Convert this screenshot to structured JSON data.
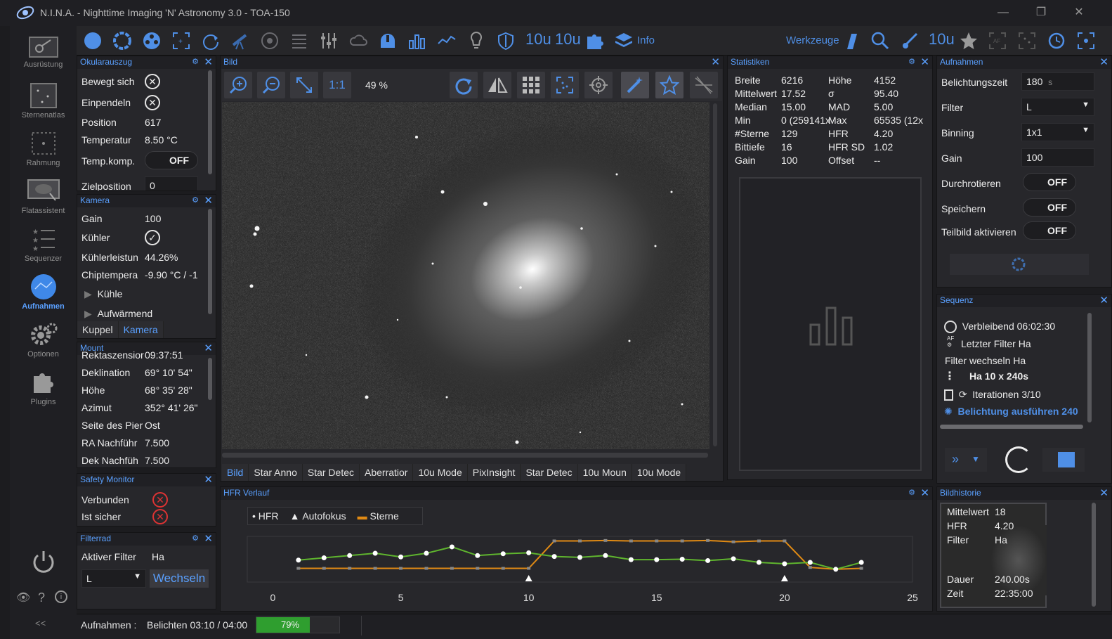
{
  "window": {
    "title": "N.I.N.A. - Nighttime Imaging 'N' Astronomy 3.0  -  TOA-150",
    "minimize": "—",
    "maximize": "❐",
    "close": "✕"
  },
  "sidebar": {
    "items": [
      {
        "label": "Ausrüstung",
        "icon": "camera-equipment-icon"
      },
      {
        "label": "Sternenatlas",
        "icon": "star-map-icon"
      },
      {
        "label": "Rahmung",
        "icon": "framing-icon"
      },
      {
        "label": "Flatassistent",
        "icon": "flat-wizard-icon"
      },
      {
        "label": "Sequenzer",
        "icon": "sequencer-icon"
      },
      {
        "label": "Aufnahmen",
        "icon": "imaging-icon",
        "active": true
      },
      {
        "label": "Optionen",
        "icon": "gear-icon"
      },
      {
        "label": "Plugins",
        "icon": "puzzle-icon"
      }
    ],
    "collapse": "<<"
  },
  "toolbar": {
    "info_label": "Info",
    "tools_label": "Werkzeuge",
    "ten_u": "10u"
  },
  "focuser": {
    "title": "Okularauszug",
    "rows": [
      {
        "label": "Bewegt sich",
        "value": ""
      },
      {
        "label": "Einpendeln",
        "value": ""
      },
      {
        "label": "Position",
        "value": "617"
      },
      {
        "label": "Temperatur",
        "value": "8.50 °C"
      },
      {
        "label": "Temp.komp.",
        "value": "OFF"
      },
      {
        "label": "Zielposition",
        "value": "0"
      }
    ]
  },
  "camera": {
    "title": "Kamera",
    "rows": [
      {
        "label": "Gain",
        "value": "100"
      },
      {
        "label": "Kühler",
        "value": ""
      },
      {
        "label": "Kühlerleistun",
        "value": "44.26%"
      },
      {
        "label": "Chiptempera",
        "value": "-9.90 °C / -1"
      }
    ],
    "expanders": [
      "Kühle",
      "Aufwärmend"
    ],
    "tabs": [
      "Kuppel",
      "Kamera"
    ]
  },
  "mount": {
    "title": "Mount",
    "rows": [
      {
        "label": "Rektaszensior",
        "value": "09:37:51"
      },
      {
        "label": "Deklination",
        "value": "69° 10' 54\""
      },
      {
        "label": "Höhe",
        "value": "68° 35' 28\""
      },
      {
        "label": "Azimut",
        "value": "352° 41' 26\""
      },
      {
        "label": "Seite des Pier",
        "value": "Ost"
      },
      {
        "label": "RA Nachführ",
        "value": "7.500"
      },
      {
        "label": "Dek Nachfüh",
        "value": "7.500"
      }
    ]
  },
  "safety": {
    "title": "Safety Monitor",
    "rows": [
      {
        "label": "Verbunden"
      },
      {
        "label": "Ist sicher"
      }
    ]
  },
  "filterwheel": {
    "title": "Filterrad",
    "active_label": "Aktiver Filter",
    "active_value": "Ha",
    "select_value": "L",
    "change_button": "Wechseln"
  },
  "image": {
    "title": "Bild",
    "one_to_one": "1:1",
    "zoom": "49 %",
    "tabs": [
      "Bild",
      "Star Anno",
      "Star Detec",
      "Aberratior",
      "10u Mode",
      "PixInsight",
      "Star Detec",
      "10u Moun",
      "10u Mode"
    ]
  },
  "statistics": {
    "title": "Statistiken",
    "rows": [
      {
        "l1": "Breite",
        "v1": "6216",
        "l2": "Höhe",
        "v2": "4152"
      },
      {
        "l1": "Mittelwert",
        "v1": "17.52",
        "l2": "σ",
        "v2": "95.40"
      },
      {
        "l1": "Median",
        "v1": "15.00",
        "l2": "MAD",
        "v2": "5.00"
      },
      {
        "l1": "Min",
        "v1": "0 (259141x",
        "l2": "Max",
        "v2": "65535 (12x"
      },
      {
        "l1": "#Sterne",
        "v1": "129",
        "l2": "HFR",
        "v2": "4.20"
      },
      {
        "l1": "Bittiefe",
        "v1": "16",
        "l2": "HFR SD",
        "v2": "1.02"
      },
      {
        "l1": "Gain",
        "v1": "100",
        "l2": "Offset",
        "v2": "--"
      }
    ]
  },
  "imaging": {
    "title": "Aufnahmen",
    "exposure_label": "Belichtungszeit",
    "exposure_value": "180",
    "exposure_unit": "s",
    "filter_label": "Filter",
    "filter_value": "L",
    "binning_label": "Binning",
    "binning_value": "1x1",
    "gain_label": "Gain",
    "gain_value": "100",
    "loop_label": "Durchrotieren",
    "loop_value": "OFF",
    "save_label": "Speichern",
    "save_value": "OFF",
    "subframe_label": "Teilbild aktivieren",
    "subframe_value": "OFF"
  },
  "sequence": {
    "title": "Sequenz",
    "remaining_label": "Verbleibend",
    "remaining_value": "06:02:30",
    "last_filter_label": "Letzter Filter",
    "last_filter_value": "Ha",
    "switch_filter_label": "Filter wechseln",
    "switch_filter_value": "Ha",
    "exposure_set": "Ha 10 x 240s",
    "iterations_label": "Iterationen",
    "iterations_value": "3/10",
    "running_item": "Belichtung ausführen 240"
  },
  "hfr": {
    "title": "HFR Verlauf",
    "legend": [
      "HFR",
      "Autofokus",
      "Sterne"
    ]
  },
  "chart_data": {
    "type": "line",
    "title": "HFR Verlauf",
    "xlim": [
      -1,
      25
    ],
    "xticks": [
      0,
      5,
      10,
      15,
      20,
      25
    ],
    "series": [
      {
        "name": "HFR",
        "color": "#5fb52e",
        "x": [
          1,
          2,
          3,
          4,
          5,
          6,
          7,
          8,
          9,
          10,
          11,
          12,
          13,
          14,
          15,
          16,
          17,
          18,
          19,
          20,
          21,
          22,
          23
        ],
        "y": [
          0.52,
          0.47,
          0.42,
          0.37,
          0.45,
          0.37,
          0.23,
          0.42,
          0.38,
          0.36,
          0.44,
          0.46,
          0.42,
          0.51,
          0.51,
          0.5,
          0.53,
          0.49,
          0.57,
          0.6,
          0.57,
          0.72,
          0.57
        ]
      },
      {
        "name": "Sterne",
        "color": "#e08a14",
        "x": [
          1,
          2,
          3,
          4,
          5,
          6,
          7,
          8,
          9,
          10,
          11,
          12,
          13,
          14,
          15,
          16,
          17,
          18,
          19,
          20,
          21,
          22,
          23
        ],
        "y": [
          0.7,
          0.7,
          0.7,
          0.7,
          0.7,
          0.7,
          0.7,
          0.7,
          0.7,
          0.7,
          0.1,
          0.1,
          0.09,
          0.1,
          0.1,
          0.1,
          0.09,
          0.12,
          0.1,
          0.1,
          0.68,
          0.72,
          0.7
        ]
      }
    ],
    "autofocus_x": [
      10,
      20
    ]
  },
  "history": {
    "title": "Bildhistorie",
    "mean_label": "Mittelwert",
    "mean_value": "18",
    "hfr_label": "HFR",
    "hfr_value": "4.20",
    "filter_label": "Filter",
    "filter_value": "Ha",
    "duration_label": "Dauer",
    "duration_value": "240.00s",
    "time_label": "Zeit",
    "time_value": "22:35:00"
  },
  "status": {
    "label": "Aufnahmen :",
    "text": "Belichten 03:10 / 04:00",
    "progress_text": "79%",
    "progress": 0.79
  },
  "colors": {
    "accent": "#5aa0ff",
    "icon_blue": "#4f8fe6",
    "progress_green": "#2f9e2f",
    "error_red": "#d33333"
  }
}
